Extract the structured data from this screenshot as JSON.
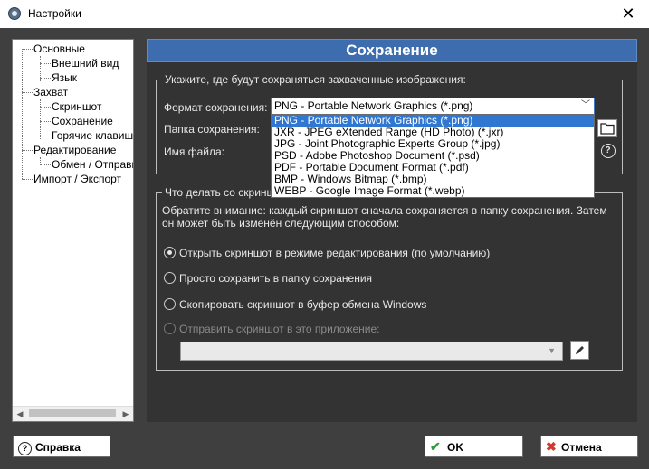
{
  "window": {
    "title": "Настройки"
  },
  "tree": {
    "items": [
      {
        "label": "Основные"
      },
      {
        "label": "Внешний вид"
      },
      {
        "label": "Язык"
      },
      {
        "label": "Захват"
      },
      {
        "label": "Скриншот"
      },
      {
        "label": "Сохранение"
      },
      {
        "label": "Горячие клавиши"
      },
      {
        "label": "Редактирование"
      },
      {
        "label": "Обмен / Отправка"
      },
      {
        "label": "Импорт / Экспорт"
      }
    ]
  },
  "panel": {
    "title": "Сохранение"
  },
  "save_group": {
    "legend": "Укажите, где будут сохраняться захваченные изображения:",
    "format_label": "Формат сохранения:",
    "format_value": "PNG - Portable Network Graphics (*.png)",
    "folder_label": "Папка сохранения:",
    "filename_label": "Имя файла:",
    "format_options": [
      "PNG - Portable Network Graphics (*.png)",
      "JXR - JPEG eXtended Range (HD Photo) (*.jxr)",
      "JPG - Joint Photographic Experts Group (*.jpg)",
      "PSD - Adobe Photoshop Document (*.psd)",
      "PDF - Portable Document Format (*.pdf)",
      "BMP - Windows Bitmap (*.bmp)",
      "WEBP - Google Image Format (*.webp)"
    ]
  },
  "action_group": {
    "legend": "Что делать со скриншот",
    "note": "Обратите внимание: каждый скриншот сначала сохраняется в папку сохранения. Затем он может быть изменён следующим способом:",
    "options": [
      "Открыть скриншот в режиме редактирования (по умолчанию)",
      "Просто сохранить в папку сохранения",
      "Скопировать скриншот в буфер обмена Windows",
      "Отправить скриншот в это приложение:"
    ],
    "selected_index": 0
  },
  "buttons": {
    "help": "Справка",
    "ok": "OK",
    "cancel": "Отмена"
  },
  "colors": {
    "accent": "#3d6dae",
    "background": "#3f3f3f",
    "panel": "#333333",
    "selection": "#3077d1"
  }
}
